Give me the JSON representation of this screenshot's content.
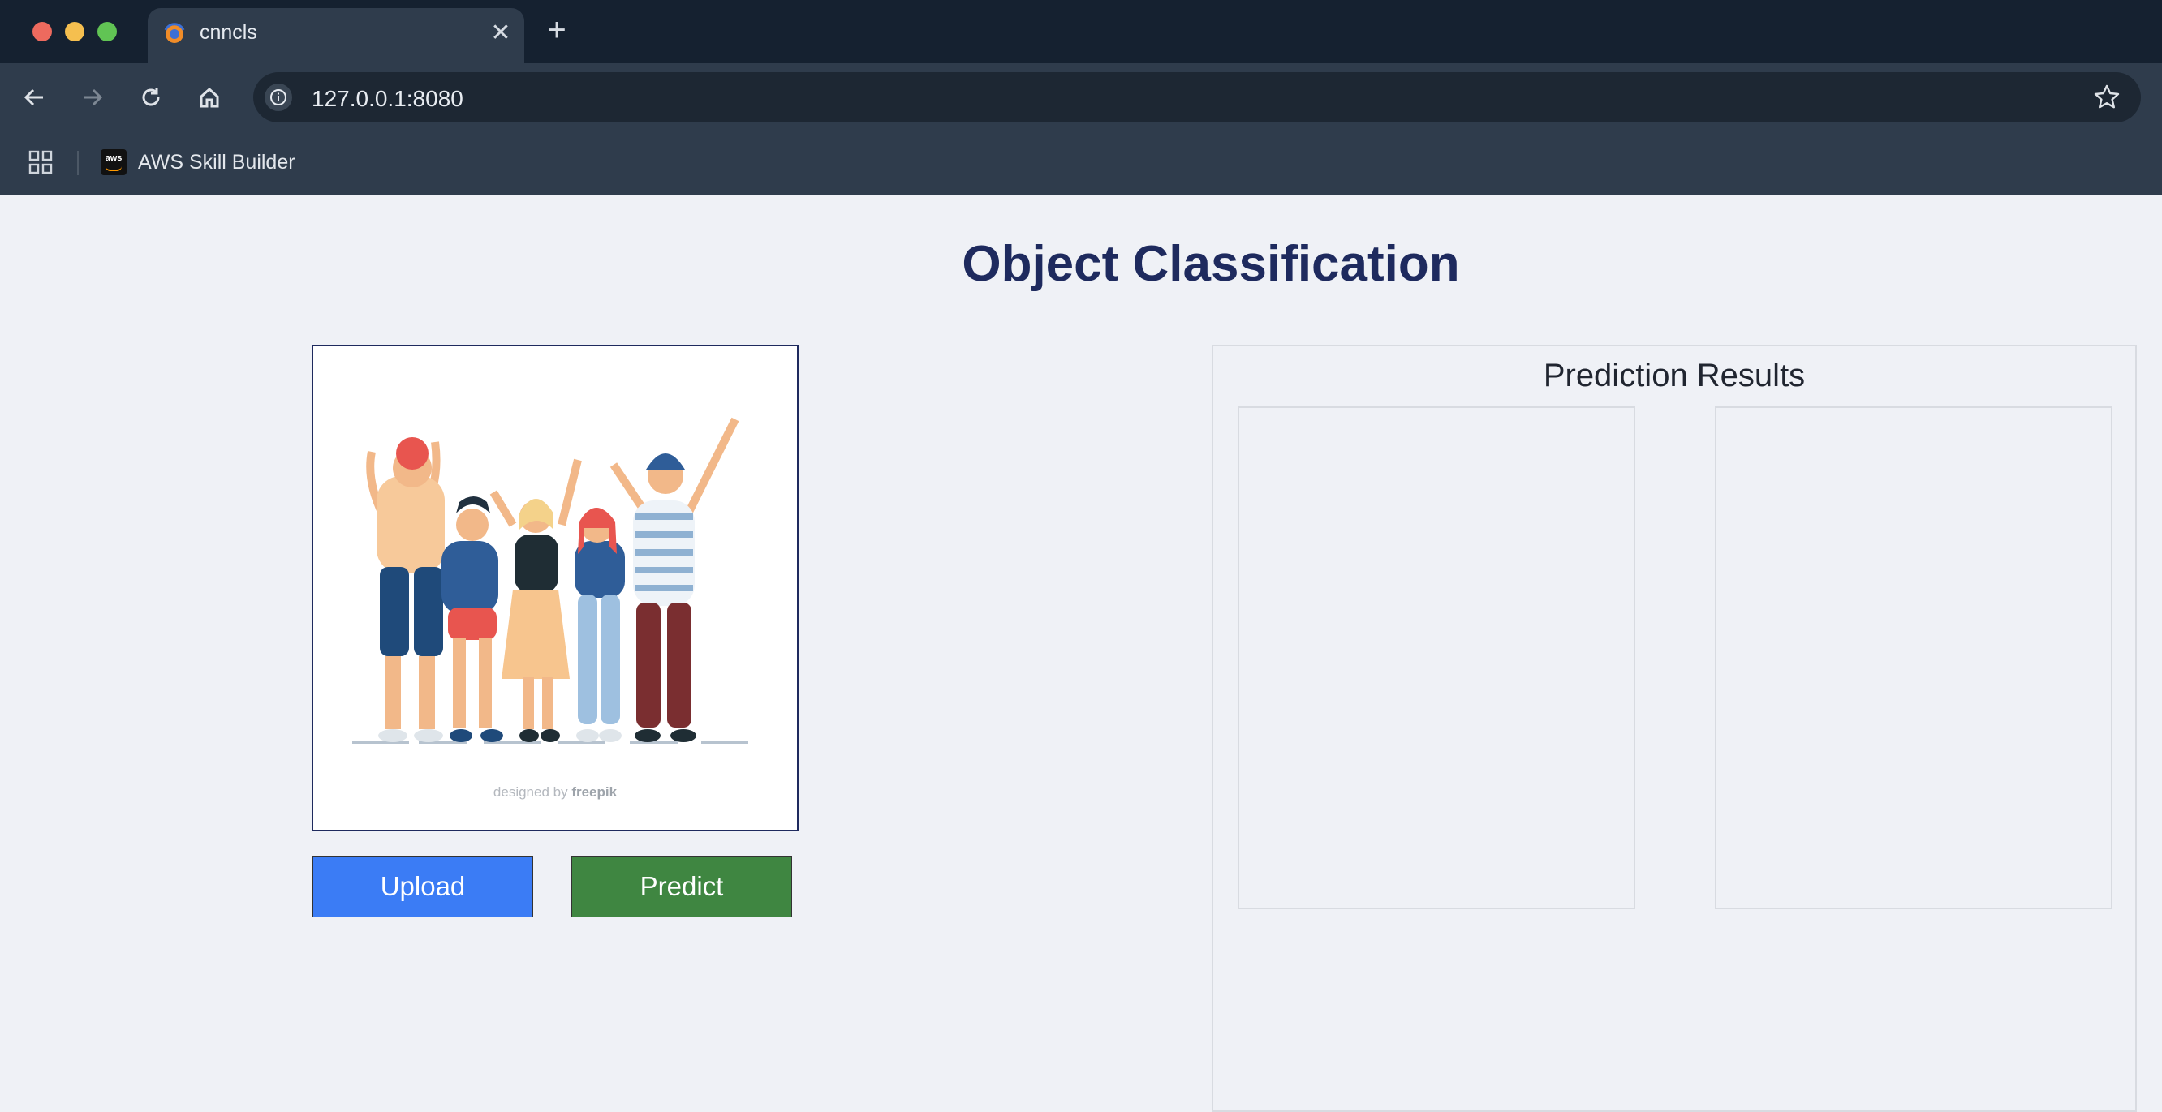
{
  "browser": {
    "tab_title": "cnncls",
    "url": "127.0.0.1:8080",
    "bookmarks": [
      {
        "label": "AWS Skill Builder",
        "icon": "aws-icon"
      }
    ]
  },
  "page": {
    "title": "Object Classification",
    "image_credit_prefix": "designed by",
    "image_credit_brand": "freepik",
    "upload_label": "Upload",
    "predict_label": "Predict",
    "results_title": "Prediction Results"
  },
  "colors": {
    "title": "#1e2a5e",
    "upload_button": "#3b7cf5",
    "predict_button": "#3f8641",
    "chrome_dark": "#152130",
    "chrome_toolbar": "#2f3c4c"
  }
}
